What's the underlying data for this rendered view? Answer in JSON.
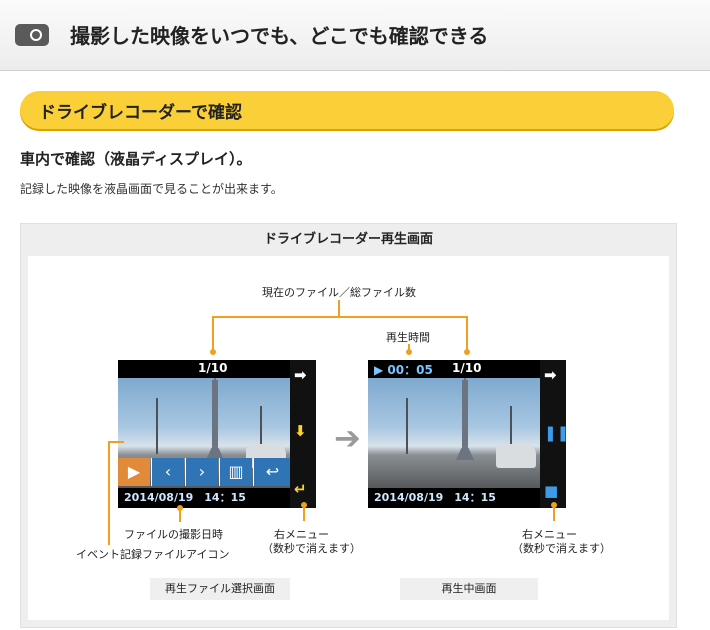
{
  "header": {
    "title": "撮影した映像をいつでも、どこでも確認できる",
    "icon": "camera-icon"
  },
  "banner": {
    "title": "ドライブレコーダーで確認"
  },
  "section": {
    "subtitle": "車内で確認（液晶ディスプレイ）。",
    "description": "記録した映像を液晶画面で見ることが出来ます。"
  },
  "panel": {
    "title": "ドライブレコーダー再生画面",
    "callouts": {
      "file_count": "現在のファイル／総ファイル数",
      "play_time": "再生時間",
      "shoot_datetime": "ファイルの撮影日時",
      "event_icon": "イベント記録ファイルアイコン",
      "right_menu_left_1": "右メニュー",
      "right_menu_left_2": "（数秒で消えます）",
      "right_menu_right_1": "右メニュー",
      "right_menu_right_2": "（数秒で消えます）"
    },
    "screen_left": {
      "file_counter": "1/10",
      "datetime": "2014/08/19　14：15",
      "caption": "再生ファイル選択画面"
    },
    "screen_right": {
      "time": "▶ 00：05",
      "file_counter": "1/10",
      "datetime": "2014/08/19　14：15",
      "caption": "再生中画面"
    }
  }
}
